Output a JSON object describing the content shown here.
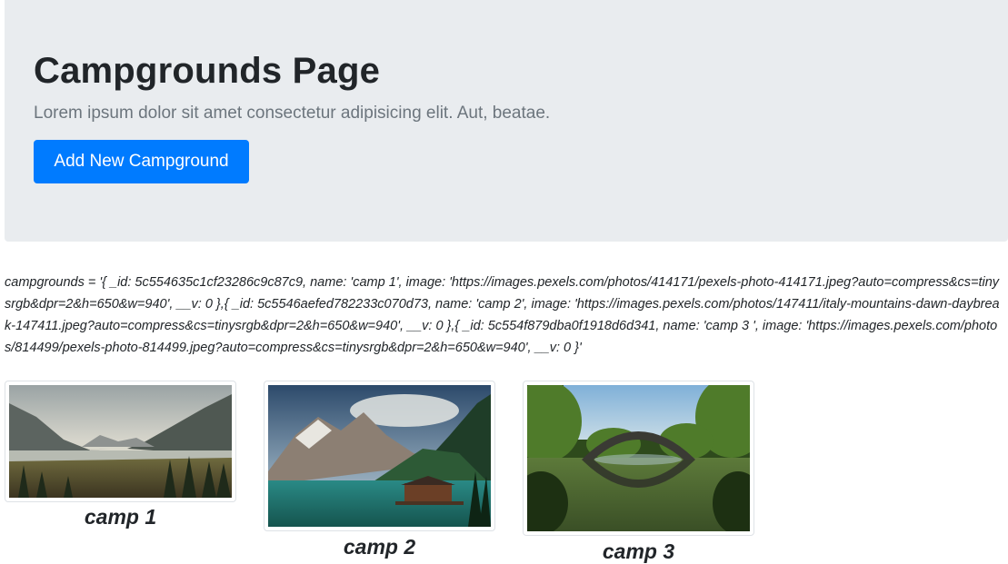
{
  "header": {
    "title": "Campgrounds Page",
    "lead": "Lorem ipsum dolor sit amet consectetur adipisicing elit. Aut, beatae.",
    "add_button_label": "Add New Campground"
  },
  "debug_output": "campgrounds = '{ _id: 5c554635c1cf23286c9c87c9, name: 'camp 1', image: 'https://images.pexels.com/photos/414171/pexels-photo-414171.jpeg?auto=compress&cs=tinysrgb&dpr=2&h=650&w=940', __v: 0 },{ _id: 5c5546aefed782233c070d73, name: 'camp 2', image: 'https://images.pexels.com/photos/147411/italy-mountains-dawn-daybreak-147411.jpeg?auto=compress&cs=tinysrgb&dpr=2&h=650&w=940', __v: 0 },{ _id: 5c554f879dba0f1918d6d341, name: 'camp 3 ', image: 'https://images.pexels.com/photos/814499/pexels-photo-814499.jpeg?auto=compress&cs=tinysrgb&dpr=2&h=650&w=940', __v: 0 }'",
  "campgrounds": [
    {
      "name": "camp 1",
      "photo": "mountain-lake-valley-photo"
    },
    {
      "name": "camp 2",
      "photo": "alpine-lake-boathouse-photo"
    },
    {
      "name": "camp 3",
      "photo": "stone-arch-bridge-reflection-photo"
    }
  ],
  "colors": {
    "jumbotron_bg": "#e9ecef",
    "primary": "#007bff",
    "text": "#212529",
    "muted": "#6c757d"
  }
}
